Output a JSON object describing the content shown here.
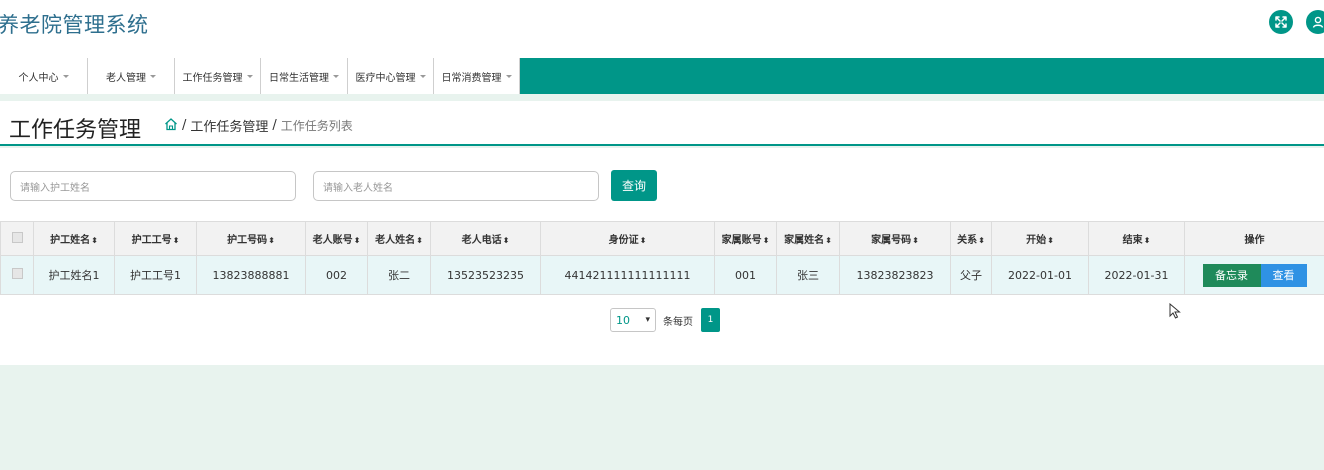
{
  "app": {
    "title": "养老院管理系统"
  },
  "header_icons": [
    {
      "name": "fullscreen-icon"
    },
    {
      "name": "user-icon"
    }
  ],
  "nav": {
    "items": [
      {
        "label": "个人中心"
      },
      {
        "label": "老人管理"
      },
      {
        "label": "工作任务管理"
      },
      {
        "label": "日常生活管理"
      },
      {
        "label": "医疗中心管理"
      },
      {
        "label": "日常消费管理"
      }
    ]
  },
  "page": {
    "title": "工作任务管理",
    "breadcrumb": {
      "home_icon": "home-icon",
      "sep": "/",
      "section": "工作任务管理",
      "current": "工作任务列表"
    }
  },
  "search": {
    "nurse_name_placeholder": "请输入护工姓名",
    "elder_name_placeholder": "请输入老人姓名",
    "query_label": "查询"
  },
  "table": {
    "sort_icon": "⬍",
    "headers": [
      "护工姓名",
      "护工工号",
      "护工号码",
      "老人账号",
      "老人姓名",
      "老人电话",
      "身份证",
      "家属账号",
      "家属姓名",
      "家属号码",
      "关系",
      "开始",
      "结束",
      "操作"
    ],
    "rows": [
      {
        "nurse_name": "护工姓名1",
        "nurse_id": "护工工号1",
        "nurse_phone": "13823888881",
        "elder_account": "002",
        "elder_name": "张二",
        "elder_phone": "13523523235",
        "id_card": "441421111111111111",
        "family_account": "001",
        "family_name": "张三",
        "family_phone": "13823823823",
        "relation": "父子",
        "start": "2022-01-01",
        "end": "2022-01-31",
        "actions": {
          "memo": "备忘录",
          "view": "查看"
        }
      }
    ]
  },
  "pagination": {
    "page_size": "10",
    "per_page_label": "条每页",
    "current_page": "1"
  },
  "colors": {
    "primary": "#009688",
    "title": "#2e6f8e",
    "memo_button": "#1f8a5a",
    "view_button": "#2f92e4",
    "row_bg": "#e8f6f7",
    "page_bg": "#e8f3ee"
  }
}
